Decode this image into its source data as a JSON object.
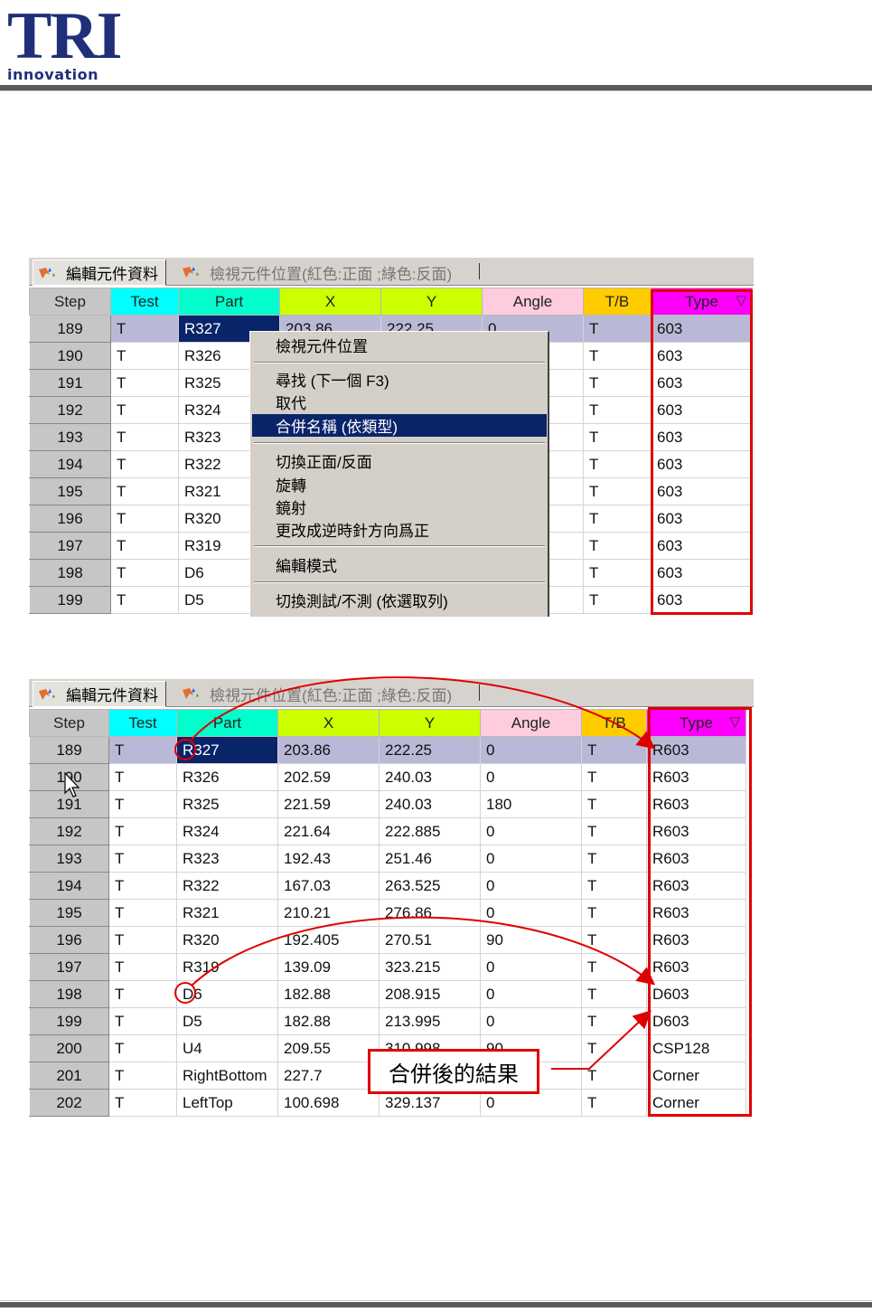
{
  "header": {
    "logo_text": "TRI",
    "logo_sub": "innovation"
  },
  "tabs": {
    "edit_label": "編輯元件資料",
    "view_label": "檢視元件位置(紅色:正面 ;綠色:反面)"
  },
  "columns": [
    "Step",
    "Test",
    "Part",
    "X",
    "Y",
    "Angle",
    "T/B",
    "Type"
  ],
  "filter_glyph": "▽",
  "colors": {
    "step": "#c6c6c6",
    "test": "#00ffff",
    "part": "#00ffcc",
    "x": "#ccff00",
    "y": "#ccff00",
    "angle": "#ffccdd",
    "tb": "#ffcc00",
    "type": "#ff00ff",
    "highlight": "#e00000",
    "selection": "#0a246a"
  },
  "table1": {
    "rows": [
      [
        "189",
        "T",
        "R327",
        "203.86",
        "222.25",
        "0",
        "T",
        "603"
      ],
      [
        "190",
        "T",
        "R326",
        "",
        "",
        "",
        "T",
        "603"
      ],
      [
        "191",
        "T",
        "R325",
        "",
        "",
        "",
        "T",
        "603"
      ],
      [
        "192",
        "T",
        "R324",
        "",
        "",
        "",
        "T",
        "603"
      ],
      [
        "193",
        "T",
        "R323",
        "",
        "",
        "",
        "T",
        "603"
      ],
      [
        "194",
        "T",
        "R322",
        "",
        "",
        "",
        "T",
        "603"
      ],
      [
        "195",
        "T",
        "R321",
        "",
        "",
        "",
        "T",
        "603"
      ],
      [
        "196",
        "T",
        "R320",
        "",
        "",
        "",
        "T",
        "603"
      ],
      [
        "197",
        "T",
        "R319",
        "",
        "",
        "",
        "T",
        "603"
      ],
      [
        "198",
        "T",
        "D6",
        "",
        "",
        "",
        "T",
        "603"
      ],
      [
        "199",
        "T",
        "D5",
        "",
        "",
        "",
        "T",
        "603"
      ]
    ]
  },
  "context_menu": {
    "items": [
      "檢視元件位置",
      "尋找 (下一個 F3)",
      "取代",
      "合併名稱 (依類型)",
      "切換正面/反面",
      "旋轉",
      "鏡射",
      "更改成逆時針方向爲正",
      "編輯模式",
      "切換測試/不測 (依選取列)"
    ],
    "highlighted_index": 3
  },
  "table2": {
    "rows": [
      [
        "189",
        "T",
        "R327",
        "203.86",
        "222.25",
        "0",
        "T",
        "R603"
      ],
      [
        "190",
        "T",
        "R326",
        "202.59",
        "240.03",
        "0",
        "T",
        "R603"
      ],
      [
        "191",
        "T",
        "R325",
        "221.59",
        "240.03",
        "180",
        "T",
        "R603"
      ],
      [
        "192",
        "T",
        "R324",
        "221.64",
        "222.885",
        "0",
        "T",
        "R603"
      ],
      [
        "193",
        "T",
        "R323",
        "192.43",
        "251.46",
        "0",
        "T",
        "R603"
      ],
      [
        "194",
        "T",
        "R322",
        "167.03",
        "263.525",
        "0",
        "T",
        "R603"
      ],
      [
        "195",
        "T",
        "R321",
        "210.21",
        "276.86",
        "0",
        "T",
        "R603"
      ],
      [
        "196",
        "T",
        "R320",
        "192.405",
        "270.51",
        "90",
        "T",
        "R603"
      ],
      [
        "197",
        "T",
        "R319",
        "139.09",
        "323.215",
        "0",
        "T",
        "R603"
      ],
      [
        "198",
        "T",
        "D6",
        "182.88",
        "208.915",
        "0",
        "T",
        "D603"
      ],
      [
        "199",
        "T",
        "D5",
        "182.88",
        "213.995",
        "0",
        "T",
        "D603"
      ],
      [
        "200",
        "T",
        "U4",
        "209.55",
        "310.998",
        "90",
        "T",
        "CSP128"
      ],
      [
        "201",
        "T",
        "RightBottom",
        "227.7",
        "",
        "",
        "T",
        "Corner"
      ],
      [
        "202",
        "T",
        "LeftTop",
        "100.698",
        "329.137",
        "0",
        "T",
        "Corner"
      ]
    ]
  },
  "callout": {
    "text": "合併後的結果"
  }
}
